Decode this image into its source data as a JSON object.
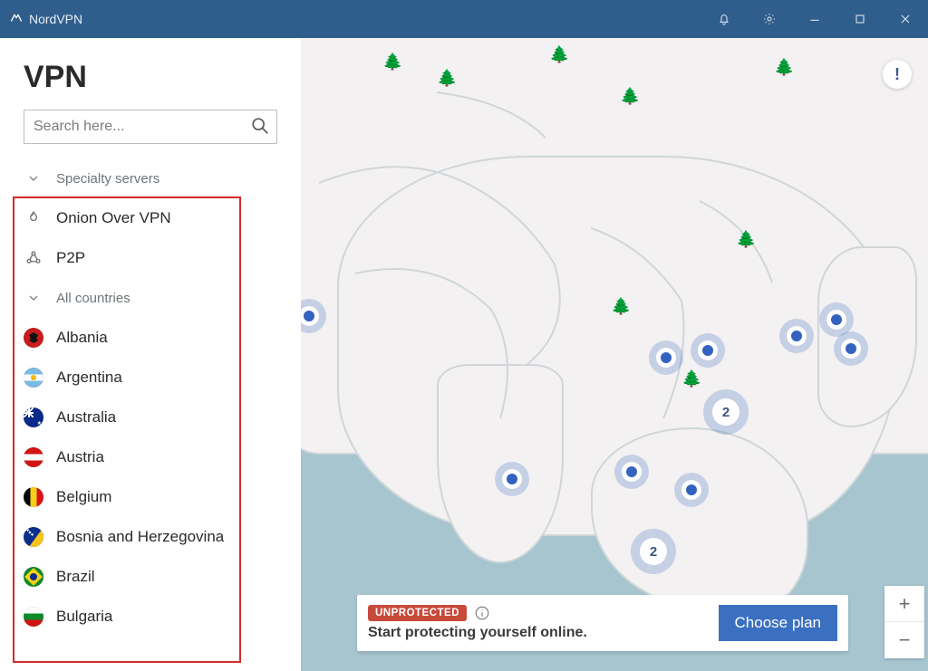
{
  "titlebar": {
    "app_name": "NordVPN"
  },
  "sidebar": {
    "title": "VPN",
    "search_placeholder": "Search here...",
    "specialty_header": "Specialty servers",
    "specialty": [
      {
        "label": "Onion Over VPN",
        "icon": "onion-icon"
      },
      {
        "label": "P2P",
        "icon": "p2p-icon"
      }
    ],
    "all_countries_header": "All countries",
    "countries": [
      {
        "label": "Albania",
        "flag": "al"
      },
      {
        "label": "Argentina",
        "flag": "ar"
      },
      {
        "label": "Australia",
        "flag": "au"
      },
      {
        "label": "Austria",
        "flag": "at"
      },
      {
        "label": "Belgium",
        "flag": "be"
      },
      {
        "label": "Bosnia and Herzegovina",
        "flag": "ba"
      },
      {
        "label": "Brazil",
        "flag": "br"
      },
      {
        "label": "Bulgaria",
        "flag": "bg"
      }
    ]
  },
  "map": {
    "alert_badge": "!",
    "cluster_counts": {
      "c1": "2",
      "c2": "2"
    }
  },
  "status": {
    "badge": "UNPROTECTED",
    "message": "Start protecting yourself online.",
    "cta": "Choose plan"
  },
  "zoom": {
    "in": "+",
    "out": "−"
  }
}
